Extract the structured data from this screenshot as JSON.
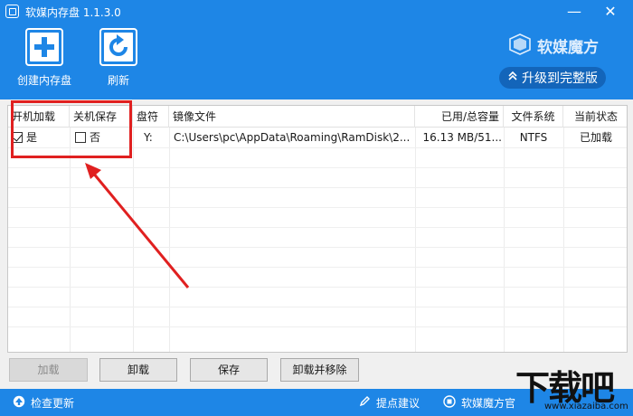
{
  "window": {
    "title": "软媒内存盘 1.1.3.0",
    "minimize": "—",
    "close": "✕"
  },
  "toolbar": {
    "create_label": "创建内存盘",
    "refresh_label": "刷新"
  },
  "brand": {
    "name": "软媒魔方",
    "upgrade_label": "升级到完整版",
    "upgrade_icon": "double-chevron-up-icon"
  },
  "table": {
    "columns": [
      "开机加载",
      "关机保存",
      "盘符",
      "镜像文件",
      "已用/总容量",
      "文件系统",
      "当前状态"
    ],
    "rows": [
      {
        "boot_load": "是",
        "boot_load_checked": true,
        "shutdown_save": "否",
        "shutdown_save_checked": false,
        "drive": "Y:",
        "image": "C:\\Users\\pc\\AppData\\Roaming\\RamDisk\\2...",
        "usage": "16.13 MB/51...",
        "fs": "NTFS",
        "status": "已加载"
      }
    ]
  },
  "buttons": {
    "load": "加载",
    "unload": "卸载",
    "save": "保存",
    "unload_remove": "卸载并移除"
  },
  "statusbar": {
    "check_update": "检查更新",
    "feedback": "提点建议",
    "brand_link": "软媒魔方官"
  },
  "watermark": {
    "text": "下载吧",
    "sub": "www.xiazaiba.com"
  },
  "colors": {
    "primary_blue": "#1e86e6",
    "highlight_red": "#e02020"
  }
}
